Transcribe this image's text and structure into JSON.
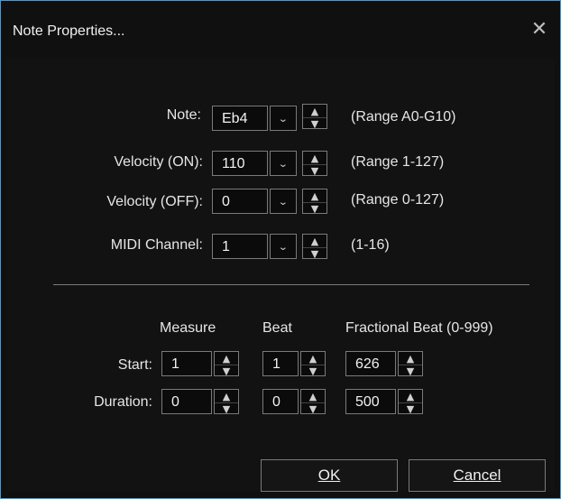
{
  "dialog": {
    "title": "Note Properties...",
    "close_icon": "close-icon"
  },
  "note": {
    "label": "Note:",
    "value": "Eb4",
    "range": "(Range A0-G10)"
  },
  "velocity_on": {
    "label": "Velocity (ON):",
    "value": "110",
    "range": "(Range 1-127)"
  },
  "velocity_off": {
    "label": "Velocity (OFF):",
    "value": "0",
    "range": "(Range 0-127)"
  },
  "midi_channel": {
    "label": "MIDI Channel:",
    "value": "1",
    "range": "(1-16)"
  },
  "timing": {
    "header_measure": "Measure",
    "header_beat": "Beat",
    "header_fractional": "Fractional Beat (0-999)",
    "start_label": "Start:",
    "duration_label": "Duration:",
    "start": {
      "measure": "1",
      "beat": "1",
      "fractional": "626"
    },
    "duration": {
      "measure": "0",
      "beat": "0",
      "fractional": "500"
    }
  },
  "buttons": {
    "ok": "OK",
    "cancel": "Cancel"
  }
}
